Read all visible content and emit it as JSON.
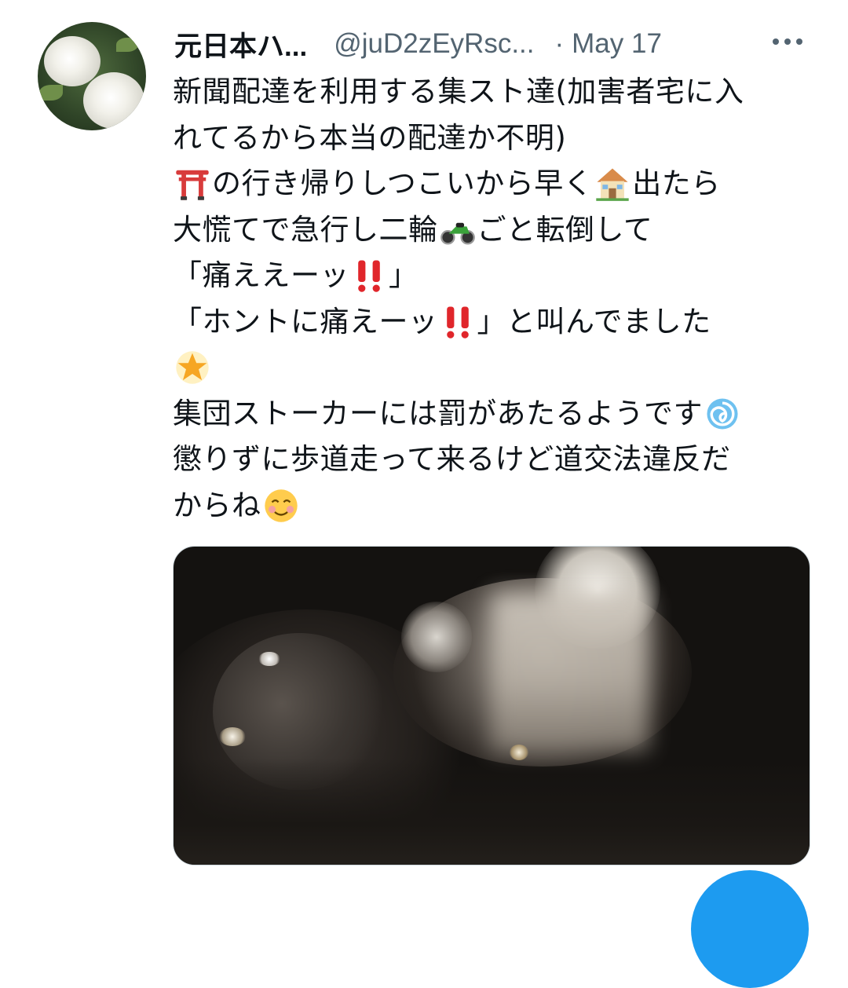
{
  "tweet": {
    "display_name": "元日本ハ...",
    "handle": "@juD2zEyRsc...",
    "separator": "·",
    "date": "May 17",
    "lines": [
      [
        "新聞配達を利用する集スト達(加害者宅に入"
      ],
      [
        "れてるから本当の配達か不明)"
      ],
      [
        {
          "emoji": "torii-gate"
        },
        "の行き帰りしつこいから早く",
        {
          "emoji": "house"
        },
        "出たら"
      ],
      [
        "大慌てで急行し二輪",
        {
          "emoji": "motorcycle"
        },
        "ごと転倒して"
      ],
      [
        "「痛ええーッ",
        {
          "emoji": "double-exclamation"
        },
        "」"
      ],
      [
        "「ホントに痛えーッ",
        {
          "emoji": "double-exclamation"
        },
        "」と叫んでました"
      ],
      [
        {
          "emoji": "glowing-star"
        }
      ],
      [
        "集団ストーカーには罰があたるようです",
        {
          "emoji": "cyclone"
        }
      ],
      [
        "懲りずに歩道走って来るけど道交法違反だ"
      ],
      [
        "からね",
        {
          "emoji": "smiling-face"
        }
      ]
    ]
  },
  "colors": {
    "text": "#0f1419",
    "secondary": "#536471",
    "accent": "#1d9bf0"
  },
  "icons": {
    "more": "more-horizontal-icon",
    "compose": "compose-fab"
  }
}
